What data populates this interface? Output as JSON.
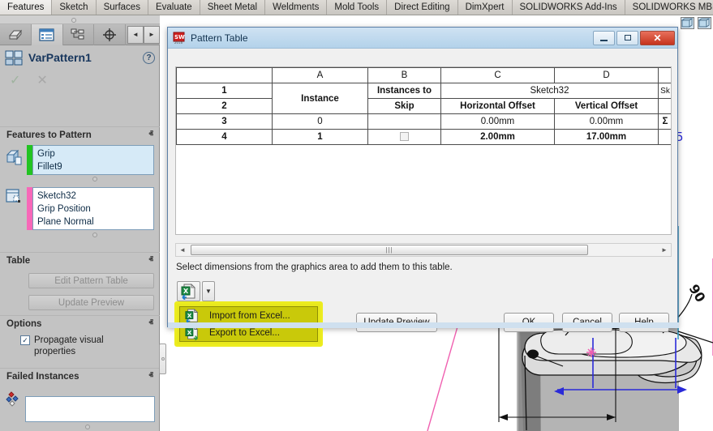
{
  "command_manager": {
    "tabs": [
      {
        "label": "Features",
        "active": true
      },
      {
        "label": "Sketch",
        "active": false
      },
      {
        "label": "Surfaces",
        "active": false
      },
      {
        "label": "Evaluate",
        "active": false
      },
      {
        "label": "Sheet Metal",
        "active": false
      },
      {
        "label": "Weldments",
        "active": false
      },
      {
        "label": "Mold Tools",
        "active": false
      },
      {
        "label": "Direct Editing",
        "active": false
      },
      {
        "label": "DimXpert",
        "active": false
      },
      {
        "label": "SOLIDWORKS Add-Ins",
        "active": false
      },
      {
        "label": "SOLIDWORKS MBD",
        "active": false
      }
    ]
  },
  "feature_manager": {
    "tab_icons": [
      {
        "name": "feature-tree-icon",
        "selected": false
      },
      {
        "name": "property-manager-icon",
        "selected": true
      },
      {
        "name": "configuration-manager-icon",
        "selected": false
      },
      {
        "name": "dimxpert-manager-icon",
        "selected": false
      }
    ],
    "nav_prev": "◄",
    "nav_next": "►",
    "title": "VarPattern1",
    "help_glyph": "?",
    "ok_glyph": "✓",
    "cancel_glyph": "✕",
    "sections": [
      {
        "name": "features-to-pattern",
        "title": "Features to Pattern",
        "chevron": "ⱏ",
        "selection_items": [
          "Grip",
          "Fillet9"
        ],
        "accent_color": "#22c322"
      },
      {
        "name": "reference-sketch",
        "title": "",
        "chevron": "",
        "selection_items": [
          "Sketch32",
          "Grip Position",
          "Plane Normal"
        ],
        "accent_color": "#f768b8"
      },
      {
        "name": "table",
        "title": "Table",
        "chevron": "ⱏ",
        "buttons": [
          "Edit Pattern Table",
          "Update Preview"
        ]
      },
      {
        "name": "options",
        "title": "Options",
        "chevron": "ⱏ",
        "checkbox": {
          "label": "Propagate visual properties",
          "checked": true,
          "glyph": "✓"
        }
      },
      {
        "name": "failed-instances",
        "title": "Failed Instances",
        "chevron": "ⱏ",
        "list_value": ""
      }
    ]
  },
  "dialog": {
    "title": "Pattern Table",
    "app_icon": "solidworks-icon",
    "window_buttons": {
      "minimize": "minimize-icon",
      "maximize": "maximize-icon",
      "close": "✕"
    },
    "table": {
      "column_letters": [
        "",
        "A",
        "B",
        "C",
        "D",
        ""
      ],
      "rows": [
        {
          "num": "1",
          "cells": [
            "Instance",
            "Instances to",
            "Sketch32",
            "Sk"
          ],
          "note": "row1-merged-sketch-header"
        },
        {
          "num": "2",
          "cells": [
            "",
            "Skip",
            "Horizontal Offset",
            "Vertical Offset",
            ""
          ]
        },
        {
          "num": "3",
          "cells": [
            "0",
            "",
            "0.00mm",
            "0.00mm",
            "Σ"
          ],
          "dim": true
        },
        {
          "num": "4",
          "cells": [
            "1",
            "checkbox",
            "2.00mm",
            "17.00mm",
            ""
          ],
          "dim": false
        }
      ]
    },
    "hscrollbar": {
      "left_arrow": "◄",
      "right_arrow": "►",
      "thumb_grip": "|||"
    },
    "hint_text": "Select dimensions from the graphics area to add them to this table.",
    "excel_button": {
      "name": "excel-button",
      "caret": "▼"
    },
    "dropdown_menu": {
      "highlighted": true,
      "highlight_color": "#e8e81d",
      "items": [
        {
          "label": "Import from Excel...",
          "icon": "excel-import-icon"
        },
        {
          "label": "Export to Excel...",
          "icon": "excel-export-icon"
        }
      ]
    },
    "buttons": [
      {
        "name": "update-preview-button",
        "label": "Update Preview"
      },
      {
        "name": "ok-button",
        "label": "OK"
      },
      {
        "name": "cancel-button",
        "label": "Cancel"
      },
      {
        "name": "help-button",
        "label": "Help"
      }
    ]
  },
  "graphics_area": {
    "view_icons": [
      "view-cube-icon-1",
      "view-cube-icon-2"
    ],
    "annotations": [
      {
        "label": "5",
        "color": "#2a2ad8"
      },
      {
        "label": "90",
        "color": "#111111"
      }
    ]
  },
  "colors": {
    "accent_blue": "#17365d",
    "highlight_yellow": "#e8e81d",
    "sketch_pink": "#f060b0",
    "selection_green": "#22c322",
    "selection_pink": "#f768b8",
    "dialog_title": "#b3d2ea"
  }
}
